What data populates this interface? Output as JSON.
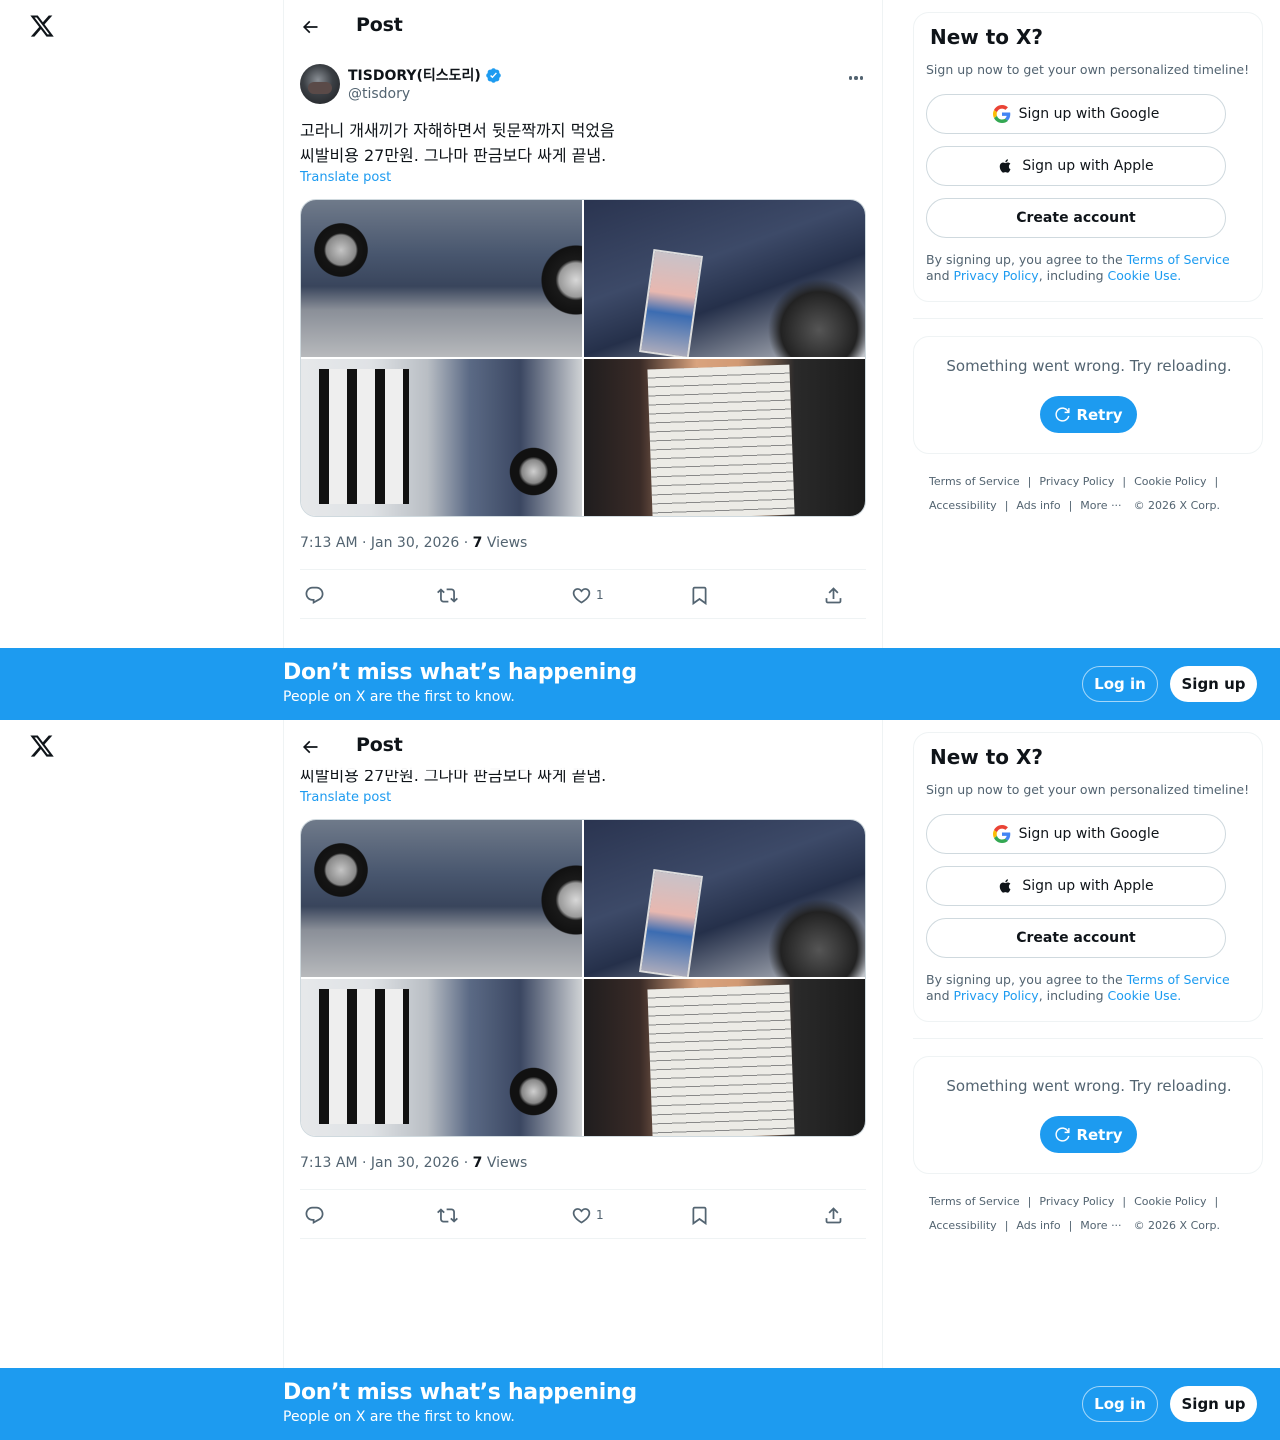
{
  "post": {
    "title": "Post",
    "author_name": "TISDORY(티스도리)",
    "author_handle": "@tisdory",
    "text": "고라니 개새끼가 자해하면서 뒷문짝까지 먹었음\n씨발비용 27만원. 그나마 판금보다 싸게 끝냄.",
    "text_line2": "씨발비용 27만원. 그나마 판금보다 싸게 끝냄.",
    "translate": "Translate post",
    "meta_time": "7:13 AM · Jan 30, 2026 · ",
    "views_count": "7",
    "views_label": " Views",
    "likes": "1",
    "images": [
      "car-side-damage",
      "car-door-repair",
      "car-in-shop",
      "receipt"
    ]
  },
  "sidebar": {
    "title": "New to X?",
    "subtitle": "Sign up now to get your own personalized timeline!",
    "google_label": "Sign up with Google",
    "apple_label": "Sign up with Apple",
    "create_label": "Create account",
    "legal_prefix": "By signing up, you agree to the ",
    "terms": "Terms of Service",
    "and": " and ",
    "privacy": "Privacy Policy",
    "including": ", including ",
    "cookie": "Cookie Use.",
    "error_text": "Something went wrong. Try reloading.",
    "retry_label": "Retry"
  },
  "footer": {
    "terms": "Terms of Service",
    "privacy": "Privacy Policy",
    "cookie": "Cookie Policy",
    "accessibility": "Accessibility",
    "ads": "Ads info",
    "more": "More ···",
    "copyright": "© 2026 X Corp."
  },
  "banner": {
    "heading": "Don’t miss what’s happening",
    "sub": "People on X are the first to know.",
    "login": "Log in",
    "signup": "Sign up"
  },
  "colors": {
    "accent": "#1d9bf0",
    "text": "#0f1419",
    "muted": "#536471"
  }
}
